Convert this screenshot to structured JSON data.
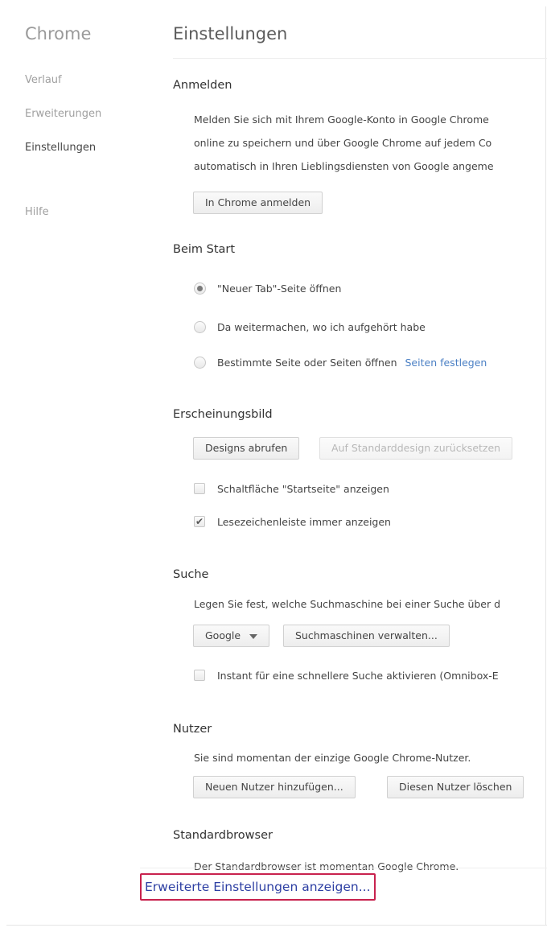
{
  "sidebar": {
    "title": "Chrome",
    "items": [
      {
        "label": "Verlauf"
      },
      {
        "label": "Erweiterungen"
      },
      {
        "label": "Einstellungen"
      },
      {
        "label": "Hilfe"
      }
    ]
  },
  "page": {
    "title": "Einstellungen"
  },
  "signin": {
    "heading": "Anmelden",
    "lines": [
      "Melden Sie sich mit Ihrem Google-Konto in Google Chrome",
      "online zu speichern und über Google Chrome auf jedem Co",
      "automatisch in Ihren Lieblingsdiensten von Google angeme"
    ],
    "button": "In Chrome anmelden"
  },
  "startup": {
    "heading": "Beim Start",
    "options": [
      {
        "label": "\"Neuer Tab\"-Seite öffnen",
        "selected": true
      },
      {
        "label": "Da weitermachen, wo ich aufgehört habe",
        "selected": false
      },
      {
        "label": "Bestimmte Seite oder Seiten öffnen",
        "selected": false
      }
    ],
    "set_pages_link": "Seiten festlegen"
  },
  "appearance": {
    "heading": "Erscheinungsbild",
    "get_themes": "Designs abrufen",
    "reset_theme": "Auf Standarddesign zurücksetzen",
    "show_home": {
      "label": "Schaltfläche \"Startseite\" anzeigen",
      "checked": false
    },
    "show_bookmarks": {
      "label": "Lesezeichenleiste immer anzeigen",
      "checked": true
    }
  },
  "search": {
    "heading": "Suche",
    "description": "Legen Sie fest, welche Suchmaschine bei einer Suche über d",
    "engine": "Google",
    "manage": "Suchmaschinen verwalten...",
    "instant": {
      "label": "Instant für eine schnellere Suche aktivieren (Omnibox-E",
      "checked": false
    }
  },
  "users": {
    "heading": "Nutzer",
    "description": "Sie sind momentan der einzige Google Chrome-Nutzer.",
    "add": "Neuen Nutzer hinzufügen...",
    "delete": "Diesen Nutzer löschen"
  },
  "default_browser": {
    "heading": "Standardbrowser",
    "description": "Der Standardbrowser ist momentan Google Chrome."
  },
  "advanced_link": "Erweiterte Einstellungen anzeigen..."
}
